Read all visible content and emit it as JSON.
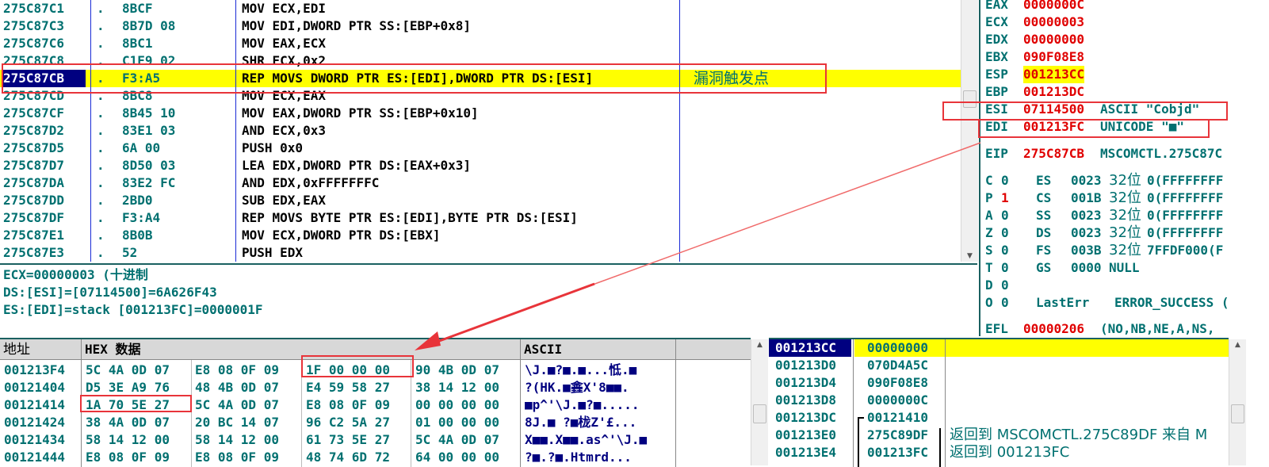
{
  "disasm": {
    "rows": [
      {
        "addr": "275C87C1",
        "dot": ".",
        "hex": "8BCF",
        "instr": "MOV ECX,EDI",
        "comment": ""
      },
      {
        "addr": "275C87C3",
        "dot": ".",
        "hex": "8B7D 08",
        "instr": "MOV EDI,DWORD PTR SS:[EBP+0x8]",
        "comment": ""
      },
      {
        "addr": "275C87C6",
        "dot": ".",
        "hex": "8BC1",
        "instr": "MOV EAX,ECX",
        "comment": ""
      },
      {
        "addr": "275C87C8",
        "dot": ".",
        "hex": "C1E9 02",
        "instr": "SHR ECX,0x2",
        "comment": ""
      },
      {
        "addr": "275C87CB",
        "dot": ".",
        "hex": "F3:A5",
        "instr": "REP MOVS DWORD PTR ES:[EDI],DWORD PTR DS:[ESI]",
        "comment": "漏洞触发点"
      },
      {
        "addr": "275C87CD",
        "dot": ".",
        "hex": "8BC8",
        "instr": "MOV ECX,EAX",
        "comment": ""
      },
      {
        "addr": "275C87CF",
        "dot": ".",
        "hex": "8B45 10",
        "instr": "MOV EAX,DWORD PTR SS:[EBP+0x10]",
        "comment": ""
      },
      {
        "addr": "275C87D2",
        "dot": ".",
        "hex": "83E1 03",
        "instr": "AND ECX,0x3",
        "comment": ""
      },
      {
        "addr": "275C87D5",
        "dot": ".",
        "hex": "6A 00",
        "instr": "PUSH 0x0",
        "comment": ""
      },
      {
        "addr": "275C87D7",
        "dot": ".",
        "hex": "8D50 03",
        "instr": "LEA EDX,DWORD PTR DS:[EAX+0x3]",
        "comment": ""
      },
      {
        "addr": "275C87DA",
        "dot": ".",
        "hex": "83E2 FC",
        "instr": "AND EDX,0xFFFFFFFC",
        "comment": ""
      },
      {
        "addr": "275C87DD",
        "dot": ".",
        "hex": "2BD0",
        "instr": "SUB EDX,EAX",
        "comment": ""
      },
      {
        "addr": "275C87DF",
        "dot": ".",
        "hex": "F3:A4",
        "instr": "REP MOVS BYTE PTR ES:[EDI],BYTE PTR DS:[ESI]",
        "comment": ""
      },
      {
        "addr": "275C87E1",
        "dot": ".",
        "hex": "8B0B",
        "instr": "MOV ECX,DWORD PTR DS:[EBX]",
        "comment": ""
      },
      {
        "addr": "275C87E3",
        "dot": ".",
        "hex": "52",
        "instr": "PUSH EDX",
        "comment": ""
      }
    ]
  },
  "info": {
    "line1": "ECX=00000003 (十进制",
    "line2": "DS:[ESI]=[07114500]=6A626F43",
    "line3": "ES:[EDI]=stack [001213FC]=0000001F"
  },
  "registers": {
    "rows": [
      {
        "name": "EAX",
        "value": "0000000C",
        "extra": ""
      },
      {
        "name": "ECX",
        "value": "00000003",
        "extra": ""
      },
      {
        "name": "EDX",
        "value": "00000000",
        "extra": ""
      },
      {
        "name": "EBX",
        "value": "090F08E8",
        "extra": ""
      },
      {
        "name": "ESP",
        "value": "001213CC",
        "extra": ""
      },
      {
        "name": "EBP",
        "value": "001213DC",
        "extra": ""
      },
      {
        "name": "ESI",
        "value": "07114500",
        "extra": "ASCII \"Cobjd\""
      },
      {
        "name": "EDI",
        "value": "001213FC",
        "extra": "UNICODE \"■\""
      }
    ],
    "eip": {
      "name": "EIP",
      "value": "275C87CB",
      "extra": "MSCOMCTL.275C87C"
    },
    "flags": [
      {
        "f": "C",
        "v": "0",
        "seg": "ES",
        "sv": "0023",
        "bits": "32位",
        "rest": "0(FFFFFFFF"
      },
      {
        "f": "P",
        "v": "1",
        "seg": "CS",
        "sv": "001B",
        "bits": "32位",
        "rest": "0(FFFFFFFF"
      },
      {
        "f": "A",
        "v": "0",
        "seg": "SS",
        "sv": "0023",
        "bits": "32位",
        "rest": "0(FFFFFFFF"
      },
      {
        "f": "Z",
        "v": "0",
        "seg": "DS",
        "sv": "0023",
        "bits": "32位",
        "rest": "0(FFFFFFFF"
      },
      {
        "f": "S",
        "v": "0",
        "seg": "FS",
        "sv": "003B",
        "bits": "32位",
        "rest": "7FFDF000(F"
      },
      {
        "f": "T",
        "v": "0",
        "seg": "GS",
        "sv": "0000",
        "bits": "",
        "rest": "NULL"
      },
      {
        "f": "D",
        "v": "0",
        "seg": "",
        "sv": "",
        "bits": "",
        "rest": ""
      },
      {
        "f": "O",
        "v": "0",
        "seg": "LastErr",
        "sv": "",
        "bits": "",
        "rest": "ERROR_SUCCESS ("
      }
    ],
    "efl": {
      "name": "EFL",
      "value": "00000206",
      "extra": "(NO,NB,NE,A,NS,"
    }
  },
  "dump": {
    "header_addr": "地址",
    "header_hex": "HEX 数据",
    "header_ascii": "ASCII",
    "rows": [
      {
        "addr": "001213F4",
        "g1": "5C 4A 0D 07",
        "g2": "E8 08 0F 09",
        "g3": "1F 00 00 00",
        "g4": "90 4B 0D 07",
        "ascii": "\\J.■?■.■...怟.■"
      },
      {
        "addr": "00121404",
        "g1": "D5 3E A9 76",
        "g2": "48 4B 0D 07",
        "g3": "E4 59 58 27",
        "g4": "38 14 12 00",
        "ascii": "?(HK.■錱X'8■■."
      },
      {
        "addr": "00121414",
        "g1": "1A 70 5E 27",
        "g2": "5C 4A 0D 07",
        "g3": "E8 08 0F 09",
        "g4": "00 00 00 00",
        "ascii": "■p^'\\J.■?■....."
      },
      {
        "addr": "00121424",
        "g1": "38 4A 0D 07",
        "g2": "20 BC 14 07",
        "g3": "96 C2 5A 27",
        "g4": "01 00 00 00",
        "ascii": "8J.■ ?■栊Z'£..."
      },
      {
        "addr": "00121434",
        "g1": "58 14 12 00",
        "g2": "58 14 12 00",
        "g3": "61 73 5E 27",
        "g4": "5C 4A 0D 07",
        "ascii": "X■■.X■■.as^'\\J.■"
      },
      {
        "addr": "00121444",
        "g1": "E8 08 0F 09",
        "g2": "E8 08 0F 09",
        "g3": "48 74 6D 72",
        "g4": "64 00 00 00",
        "ascii": "?■.?■.Htmrd..."
      }
    ]
  },
  "stack": {
    "rows": [
      {
        "addr": "001213CC",
        "value": "00000000",
        "comment": ""
      },
      {
        "addr": "001213D0",
        "value": "070D4A5C",
        "comment": ""
      },
      {
        "addr": "001213D4",
        "value": "090F08E8",
        "comment": ""
      },
      {
        "addr": "001213D8",
        "value": "0000000C",
        "comment": ""
      },
      {
        "addr": "001213DC",
        "value": "00121410",
        "comment": ""
      },
      {
        "addr": "001213E0",
        "value": "275C89DF",
        "comment": "返回到 MSCOMCTL.275C89DF 来自 M"
      },
      {
        "addr": "001213E4",
        "value": "001213FC",
        "comment": "返回到 001213FC"
      }
    ]
  },
  "colors": {
    "highlight": "#ffff00",
    "selected_addr_bg": "#000080",
    "annotation": "#e8343a",
    "column_line": "#1a2bd6"
  }
}
